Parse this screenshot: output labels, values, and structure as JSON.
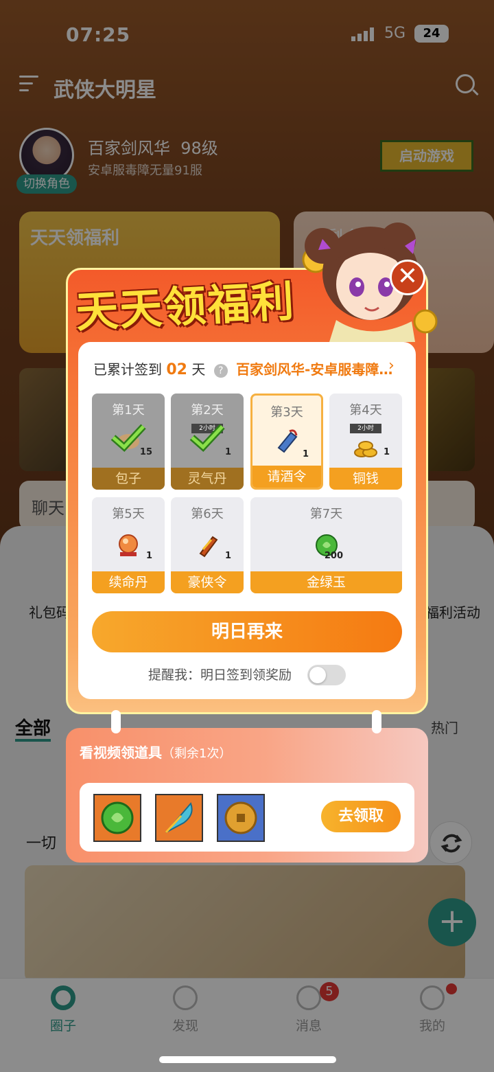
{
  "status_bar": {
    "time": "07:25",
    "network": "5G",
    "battery": "24"
  },
  "header": {
    "title": "武侠大明星"
  },
  "profile": {
    "switch_role": "切换角色",
    "role_name": "百家剑风华",
    "level": "98级",
    "server": "安卓服毒障无量91服",
    "launch_button": "启动游戏"
  },
  "cards": {
    "left_title": "天天领福利",
    "right_title": "（剩余1次）"
  },
  "chat": {
    "label": "聊天"
  },
  "tools": {
    "left_label": "礼包码",
    "right_label": "福利活动"
  },
  "feed": {
    "tab_all": "全部",
    "tab_hot": "热门",
    "post_text": "一切"
  },
  "popup": {
    "title": "天天领福利",
    "sign_prefix": "已累计签到",
    "sign_days": "02",
    "sign_unit": "天",
    "server_link": "百家剑风华-安卓服毒障…",
    "days": [
      {
        "day": "第1天",
        "item": "包子",
        "qty": "15",
        "state": "claimed",
        "icon": "bun-icon"
      },
      {
        "day": "第2天",
        "item": "灵气丹",
        "qty": "1",
        "state": "claimed",
        "icon": "pill-icon"
      },
      {
        "day": "第3天",
        "item": "请酒令",
        "qty": "1",
        "state": "today",
        "icon": "token-icon"
      },
      {
        "day": "第4天",
        "item": "铜钱",
        "qty": "1",
        "state": "normal",
        "icon": "coins-icon",
        "tag": "2小时"
      },
      {
        "day": "第5天",
        "item": "续命丹",
        "qty": "1",
        "state": "normal",
        "icon": "orb-icon"
      },
      {
        "day": "第6天",
        "item": "豪侠令",
        "qty": "1",
        "state": "normal",
        "icon": "scroll-icon"
      },
      {
        "day": "第7天",
        "item": "金绿玉",
        "qty": "200",
        "state": "normal",
        "icon": "jade-icon"
      }
    ],
    "day2_tag": "2小时",
    "tomorrow_button": "明日再来",
    "remind_label": "提醒我：明日签到领奖励",
    "remind_on": false
  },
  "video": {
    "title": "看视频领道具",
    "remaining": "（剩余1次）",
    "items": [
      "jade-icon",
      "feather-icon",
      "coin-icon"
    ],
    "claim_button": "去领取"
  },
  "bottom_nav": {
    "items": [
      "圈子",
      "发现",
      "消息",
      "我的"
    ],
    "message_badge": "5"
  },
  "colors": {
    "accent": "#2e9b8a",
    "orange": "#f07a10",
    "popup_red": "#f35a2a"
  }
}
